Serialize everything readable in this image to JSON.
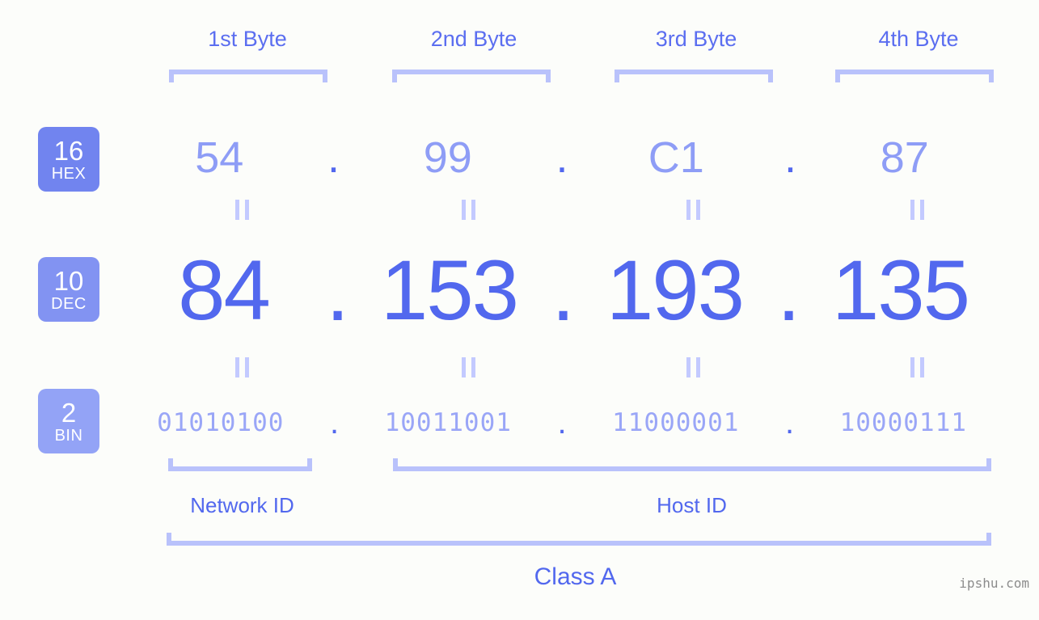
{
  "header": {
    "byte_labels": [
      "1st Byte",
      "2nd Byte",
      "3rd Byte",
      "4th Byte"
    ]
  },
  "bases": [
    {
      "number": "16",
      "name": "HEX",
      "color": "#7184ef"
    },
    {
      "number": "10",
      "name": "DEC",
      "color": "#8293f2"
    },
    {
      "number": "2",
      "name": "BIN",
      "color": "#93a3f6"
    }
  ],
  "separator": ".",
  "rows": {
    "hex": {
      "values": [
        "54",
        "99",
        "C1",
        "87"
      ]
    },
    "dec": {
      "values": [
        "84",
        "153",
        "193",
        "135"
      ]
    },
    "bin": {
      "values": [
        "01010100",
        "10011001",
        "11000001",
        "10000111"
      ]
    }
  },
  "sections": {
    "network_id": "Network ID",
    "host_id": "Host ID",
    "class": "Class A"
  },
  "watermark": "ipshu.com",
  "colors": {
    "background": "#fcfdfa",
    "accent_strong": "#5268ee",
    "accent_mid": "#8e9df6",
    "accent_light": "#b9c2fb"
  }
}
